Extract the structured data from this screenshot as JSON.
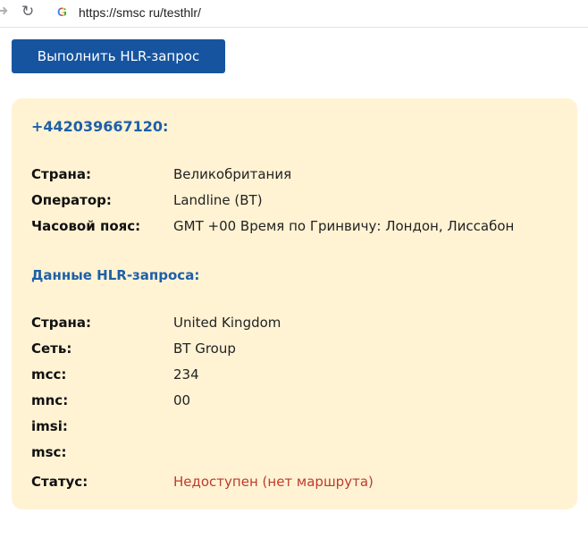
{
  "browser": {
    "url": "https://smsc ru/testhlr/",
    "forward_icon": "arrow-right-icon",
    "reload_icon": "reload-icon",
    "site_icon": "google-g-icon",
    "site_glyph": "G"
  },
  "action": {
    "button_label": "Выполнить HLR-запрос",
    "button_color": "#1654a0"
  },
  "result": {
    "phone": "+442039667120:",
    "info": [
      {
        "label": "Страна:",
        "value": "Великобритания"
      },
      {
        "label": "Оператор:",
        "value": "Landline (BT)"
      },
      {
        "label": "Часовой пояс:",
        "value": "GMT +00 Время по Гринвичу: Лондон, Лиссабон"
      }
    ],
    "hlr_title": "Данные HLR-запроса:",
    "hlr": [
      {
        "label": "Страна:",
        "value": "United Kingdom"
      },
      {
        "label": "Сеть:",
        "value": "BT Group"
      },
      {
        "label": "mcc:",
        "value": "234"
      },
      {
        "label": "mnc:",
        "value": "00"
      },
      {
        "label": "imsi:",
        "value": ""
      },
      {
        "label": "msc:",
        "value": ""
      }
    ],
    "status_label": "Статус:",
    "status_value": "Недоступен (нет маршрута)",
    "colors": {
      "card_bg": "#fff3d4",
      "heading": "#1e5fa8",
      "status": "#c0392b"
    }
  }
}
